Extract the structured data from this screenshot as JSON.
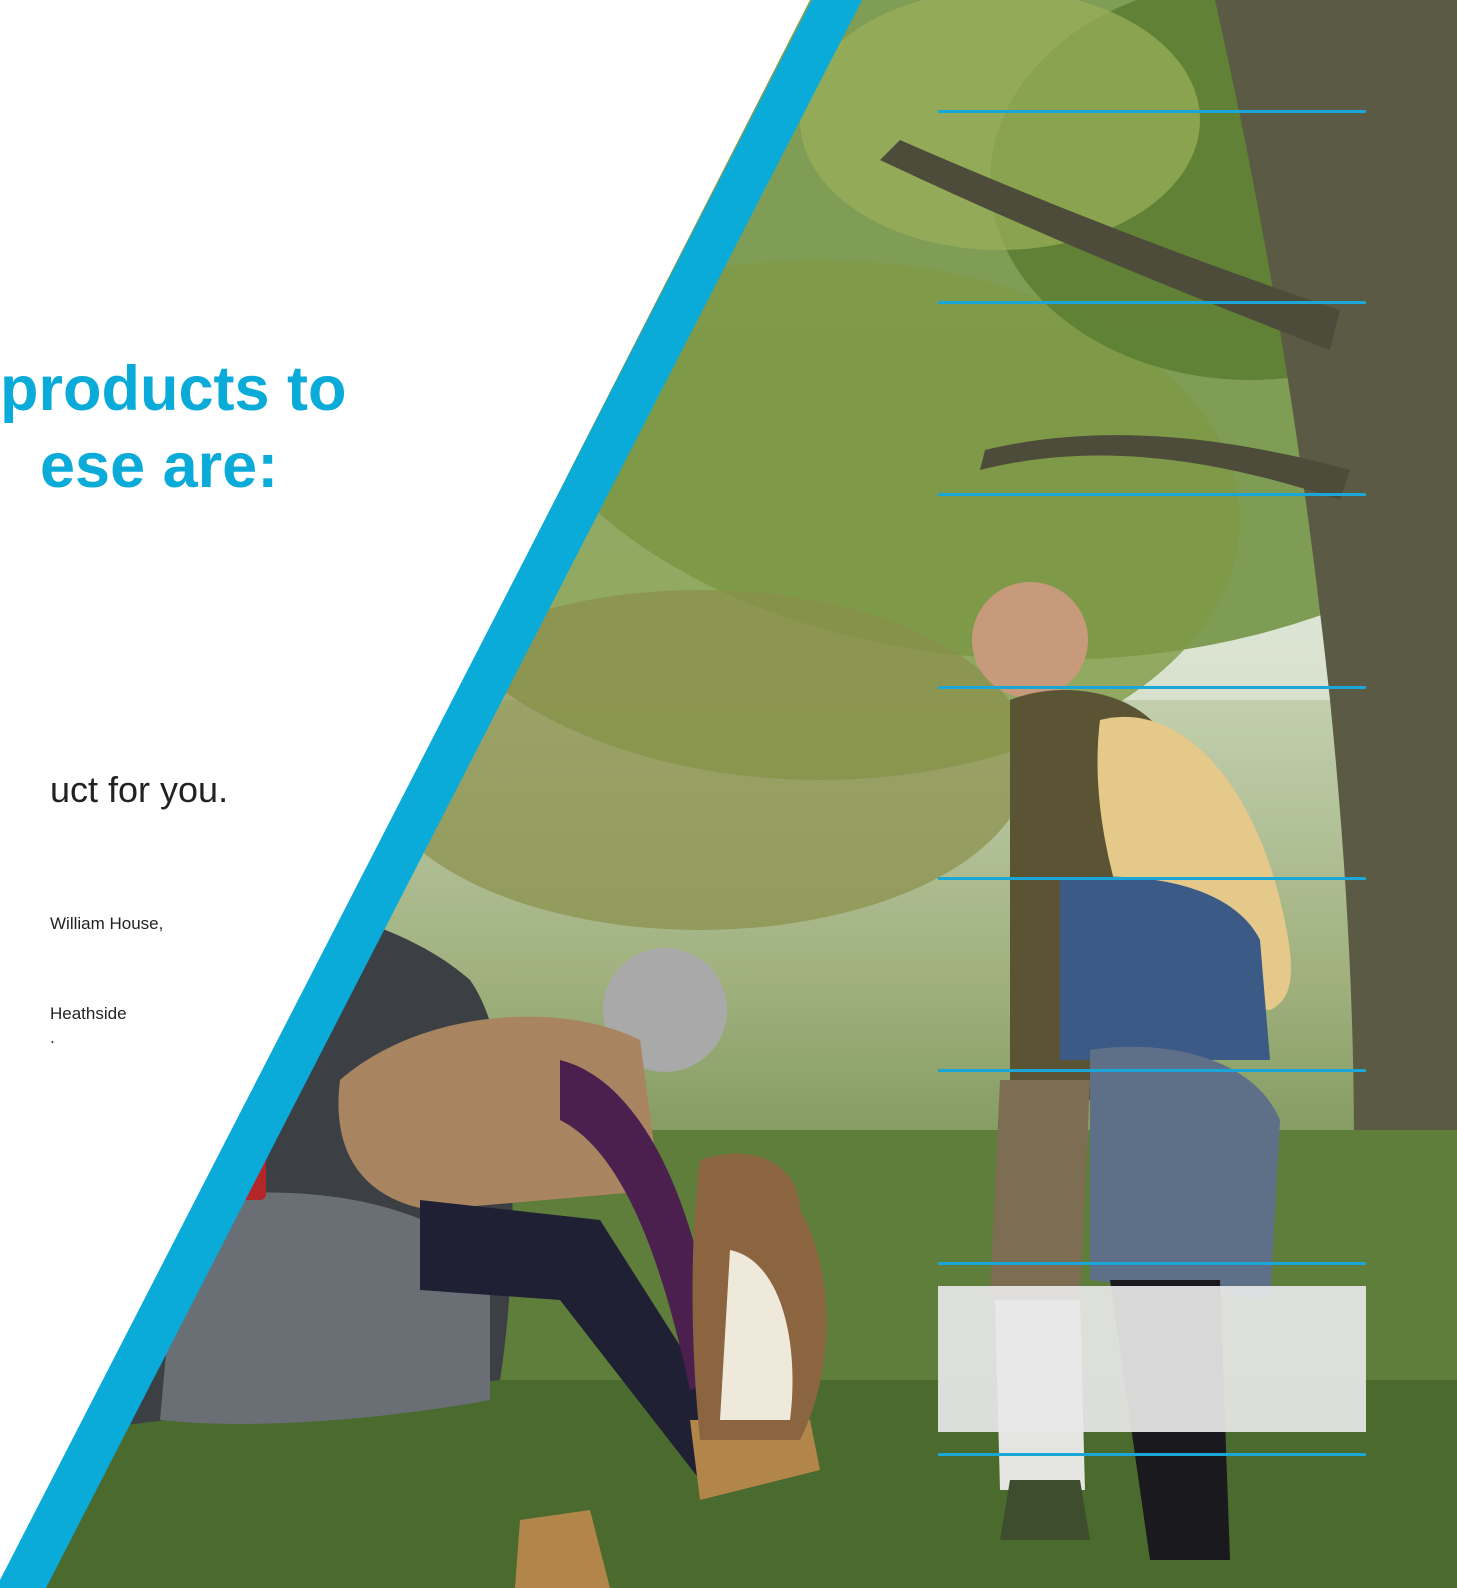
{
  "heading": {
    "line1": "products to",
    "line2": "ese are:"
  },
  "subheading": "uct for you.",
  "address": {
    "line1": "William House,",
    "line2": "Heathside",
    "line3": "."
  },
  "colors": {
    "accent": "#0aaad9",
    "rule": "#1aa6d6",
    "text": "#222222"
  },
  "photo": {
    "description_icon": "family-with-dog-under-tree-photo"
  }
}
